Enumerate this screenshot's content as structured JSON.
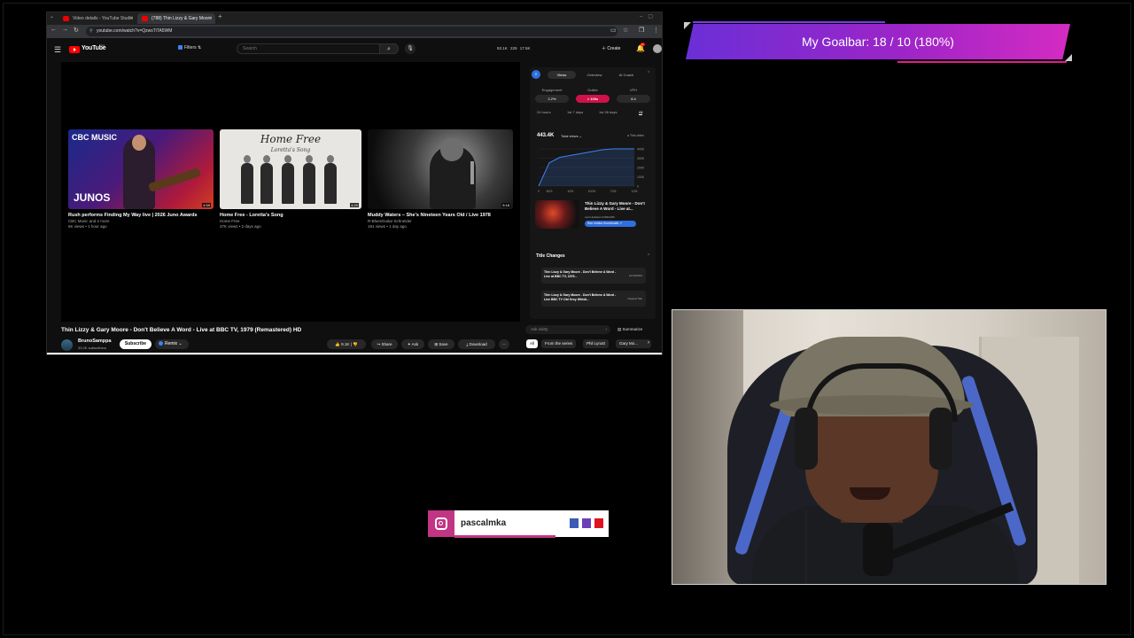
{
  "browser": {
    "tabs": [
      {
        "label": "Video details - YouTube Studio",
        "active": false
      },
      {
        "label": "(788) Thin Lizzy & Gary Moore",
        "active": true
      }
    ],
    "url": "youtube.com/watch?v=QzwsTiTA5WM"
  },
  "youtube": {
    "logo_text": "YouTube",
    "country": "CA",
    "filters_label": "Filters",
    "search_placeholder": "Search",
    "stats": "93.1K  229  17.5K",
    "create_label": "Create",
    "notif_count": "9+"
  },
  "end_cards": [
    {
      "title": "Rush performs Finding My Way live | 2026 Juno Awards",
      "channel": "CBC Music and 2 more",
      "meta": "6K views • 1 hour ago",
      "duration": "4:59",
      "brand": "CBC MUSIC",
      "overlay": "JUNOS"
    },
    {
      "title": "Home Free - Loretta's Song",
      "channel": "Home Free",
      "meta": "37K views • 2 days ago",
      "duration": "4:20",
      "brand": "Home Free",
      "subtitle": "Loretta's Song"
    },
    {
      "title": "Muddy Waters – She's Nineteen Years Old / Live 1978",
      "channel": "R-BluesGuitar Schneider",
      "meta": "191 views • 1 day ago",
      "duration": "5:18"
    }
  ],
  "video": {
    "title": "Thin Lizzy & Gary Moore - Don't Believe A Word - Live at BBC TV, 1979 (Remastered) HD",
    "channel": "BrunoSamppa",
    "subscribers": "33.2K subscribers",
    "subscribe_label": "Subscribe",
    "remix_label": "Remix",
    "likes": "9.1K",
    "actions": [
      "Share",
      "Ask",
      "Save",
      "Download"
    ]
  },
  "extension": {
    "tabs": [
      "Views",
      "Overview",
      "AI Coach"
    ],
    "metric_labels": [
      "Engagement",
      "Outlier",
      "VPH"
    ],
    "metric_values": [
      "2.2%",
      "> 100x",
      "8.4"
    ],
    "ranges": [
      "24 hours",
      "1st 7 days",
      "1st 28 days",
      "All"
    ],
    "total": "443.4K",
    "total_label": "Total views",
    "legend": "This video",
    "y_ticks": [
      "400K",
      "300K",
      "200K",
      "100K",
      "0"
    ],
    "x_ticks": [
      "0",
      "8/23",
      "4/24",
      "10/24",
      "7/25",
      "1/26"
    ],
    "related_title": "Thin Lizzy & Gary Moore - Don't Believe A Word - Live at...",
    "related_date": "Last Updated 12/09/2025",
    "related_button": "See similar thumbnails ↗",
    "title_changes_header": "Title Changes",
    "title_changes": [
      {
        "title": "Thin Lizzy & Gary Moore - Don't Believe A Word - Live at BBC TV, 1979...",
        "date": "10/10/2023"
      },
      {
        "title": "Thin Lizzy & Gary Moore - Don't Believe A Word - Live BBC TV Old Grey Whisti...",
        "date": "Original Title"
      }
    ],
    "ask_placeholder": "Ask vidIQ",
    "summarize_label": "Summarize"
  },
  "chips": [
    "All",
    "From the series",
    "Phil Lynott",
    "Gary Mo..."
  ],
  "chart_data": {
    "type": "line",
    "title": "",
    "series": [
      {
        "name": "This video",
        "values": [
          0,
          250,
          310,
          330,
          350,
          370,
          390,
          410,
          430,
          443.4
        ]
      }
    ],
    "x": [
      "0",
      "8/23",
      "",
      "4/24",
      "",
      "10/24",
      "",
      "7/25",
      "",
      "1/26"
    ],
    "ylim": [
      0,
      400
    ],
    "y_unit": "K"
  },
  "goalbar": {
    "text": "My Goalbar:  18 / 10 (180%)",
    "progress_percent": 180
  },
  "instagram": {
    "handle": "pascalmka",
    "squares": [
      "#3b5bb5",
      "#6b3fb5",
      "#e0141e"
    ]
  }
}
